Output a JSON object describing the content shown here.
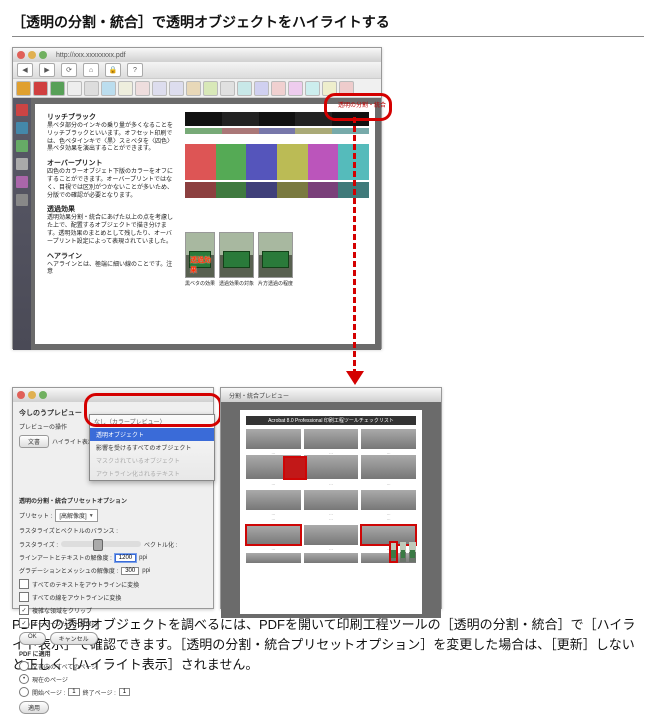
{
  "heading": "［透明の分割・統合］で透明オブジェクトをハイライトする",
  "top_window": {
    "url": "http://xxx.xxxxxxxx.pdf",
    "call_label": "透明の分割・統合",
    "doc": {
      "h1": "リッチブラック",
      "p1": "黒ベタ部分のインキの乗り量が多くなることをリッチブラックといいます。オフセット印刷では、色ベタインキで〈黒〉スミベタを〈四色〉黒ベタ効果を演出することができます。",
      "h2": "オーバープリント",
      "p2": "四色のカラーオブジェト下版のカラーをオフにすることができます。オーバープリントではなく、目視では区別がつかないことが多いため、分版での確認が必要となります。",
      "h3": "透過効果",
      "p3": "透明効果分割・統合にあげた以上の点を考慮した上で、配置するオブジェクトで描き分けます。透明効果のまとめとして残したり、オーバープリント設定によって表現されていました。",
      "h4": "ヘアライン",
      "p4": "ヘアラインとは、極端に細い線のことです。注意",
      "caption1": "黒ベタの効果",
      "caption2": "透過効果の対象",
      "caption3": "片方透過の程度",
      "red_on_photo": "透過効果"
    }
  },
  "panel": {
    "preview_header": "今しのうプレビュー",
    "section": "プレビューの操作",
    "btn_txt": "文書",
    "field_hl": "ハイライト表示 :",
    "menu": {
      "hdr": "なし（カラープレビュー）",
      "sel": "透明オブジェクト",
      "row2": "影響を受けるすべてのオブジェクト",
      "dim1": "マスクされているオブジェクト",
      "dim2": "アウトライン化されるテキスト"
    },
    "section2": "透明の分割・統合プリセットオプション",
    "preset_lbl": "プリセット :",
    "preset_val": "[高解像度]",
    "balance_lbl": "ラスタライズとベクトルのバランス :",
    "linescreen_lbl": "ラスタライズ : ",
    "vector_lbl": "ベクトル化 : ",
    "lineart_lbl": "ラインアートとテキストの解像度 :",
    "lineart_val": "1200",
    "ppi": "ppi",
    "grad_lbl": "グラデーションとメッシュの解像度 :",
    "grad_val": "300",
    "c1": "すべてのテキストをアウトラインに変換",
    "c2": "すべての線をアウトラインに変換",
    "c3": "複雑な領域をクリップ",
    "c4": "オーバープリントを保持",
    "ok": "OK",
    "cancel": "キャンセル",
    "section3": "PDF に適用",
    "rb1": "文書内のすべてのページ",
    "rb2": "現在のページ",
    "rb3": "開始ページ :",
    "to": "終了ページ :",
    "apply": "適用",
    "pg1": "1",
    "pg2": "1"
  },
  "preview_panel": {
    "title": "分割・統合プレビュー",
    "doc_hdr": "Acrobat 8.0 Professional 印刷工程ツールチェックリスト"
  },
  "body_text": "PDF内の透明オブジェクトを調べるには、PDFを開いて印刷工程ツールの［透明の分割・統合］で［ハイライト表示］で確認できます。［透明の分割・統合プリセットオプション］を変更した場合は、［更新］しないと正しく［ハイライト表示］されません。"
}
